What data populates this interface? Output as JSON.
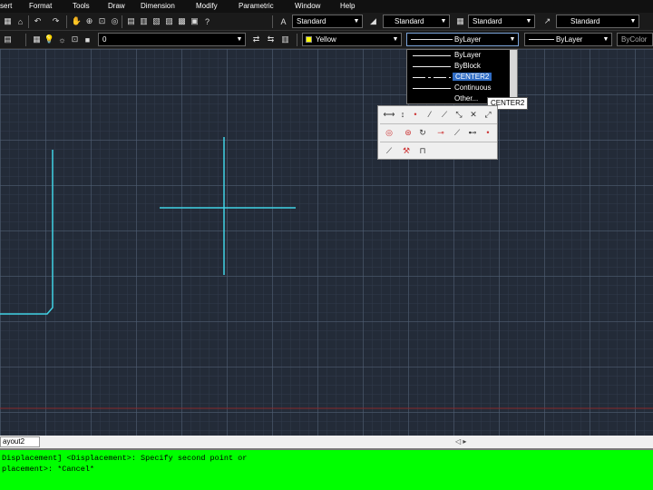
{
  "menubar": {
    "items": [
      "sert",
      "Format",
      "Tools",
      "Draw",
      "Dimension",
      "Modify",
      "Parametric",
      "Window",
      "Help"
    ]
  },
  "toolbar1": {
    "text_style": "Standard",
    "dim_style": "Standard",
    "table_style": "Standard",
    "mleader_style": "Standard"
  },
  "toolbar2": {
    "layer": "0",
    "color": "Yellow",
    "linetype": "ByLayer",
    "lineweight": "ByLayer",
    "plotstyle": "ByColor"
  },
  "linetype_dropdown": {
    "options": [
      "ByLayer",
      "ByBlock",
      "CENTER2",
      "Continuous",
      "Other..."
    ],
    "selected": "CENTER2"
  },
  "tooltip": {
    "text": "CENTER2"
  },
  "layout_tabs": {
    "tab_label": "ayout2",
    "scroll_glyph": "◁ ▸"
  },
  "command_line": {
    "line1": "Displacement] <Displacement>: Specify second point or",
    "line2": "placement>: *Cancel*"
  },
  "colors": {
    "canvas_bg": "#232b38",
    "geometry": "#41d3e6",
    "command_bg": "#00ff00",
    "selection": "#2f6cc4",
    "yellow_swatch": "#ffff00"
  }
}
